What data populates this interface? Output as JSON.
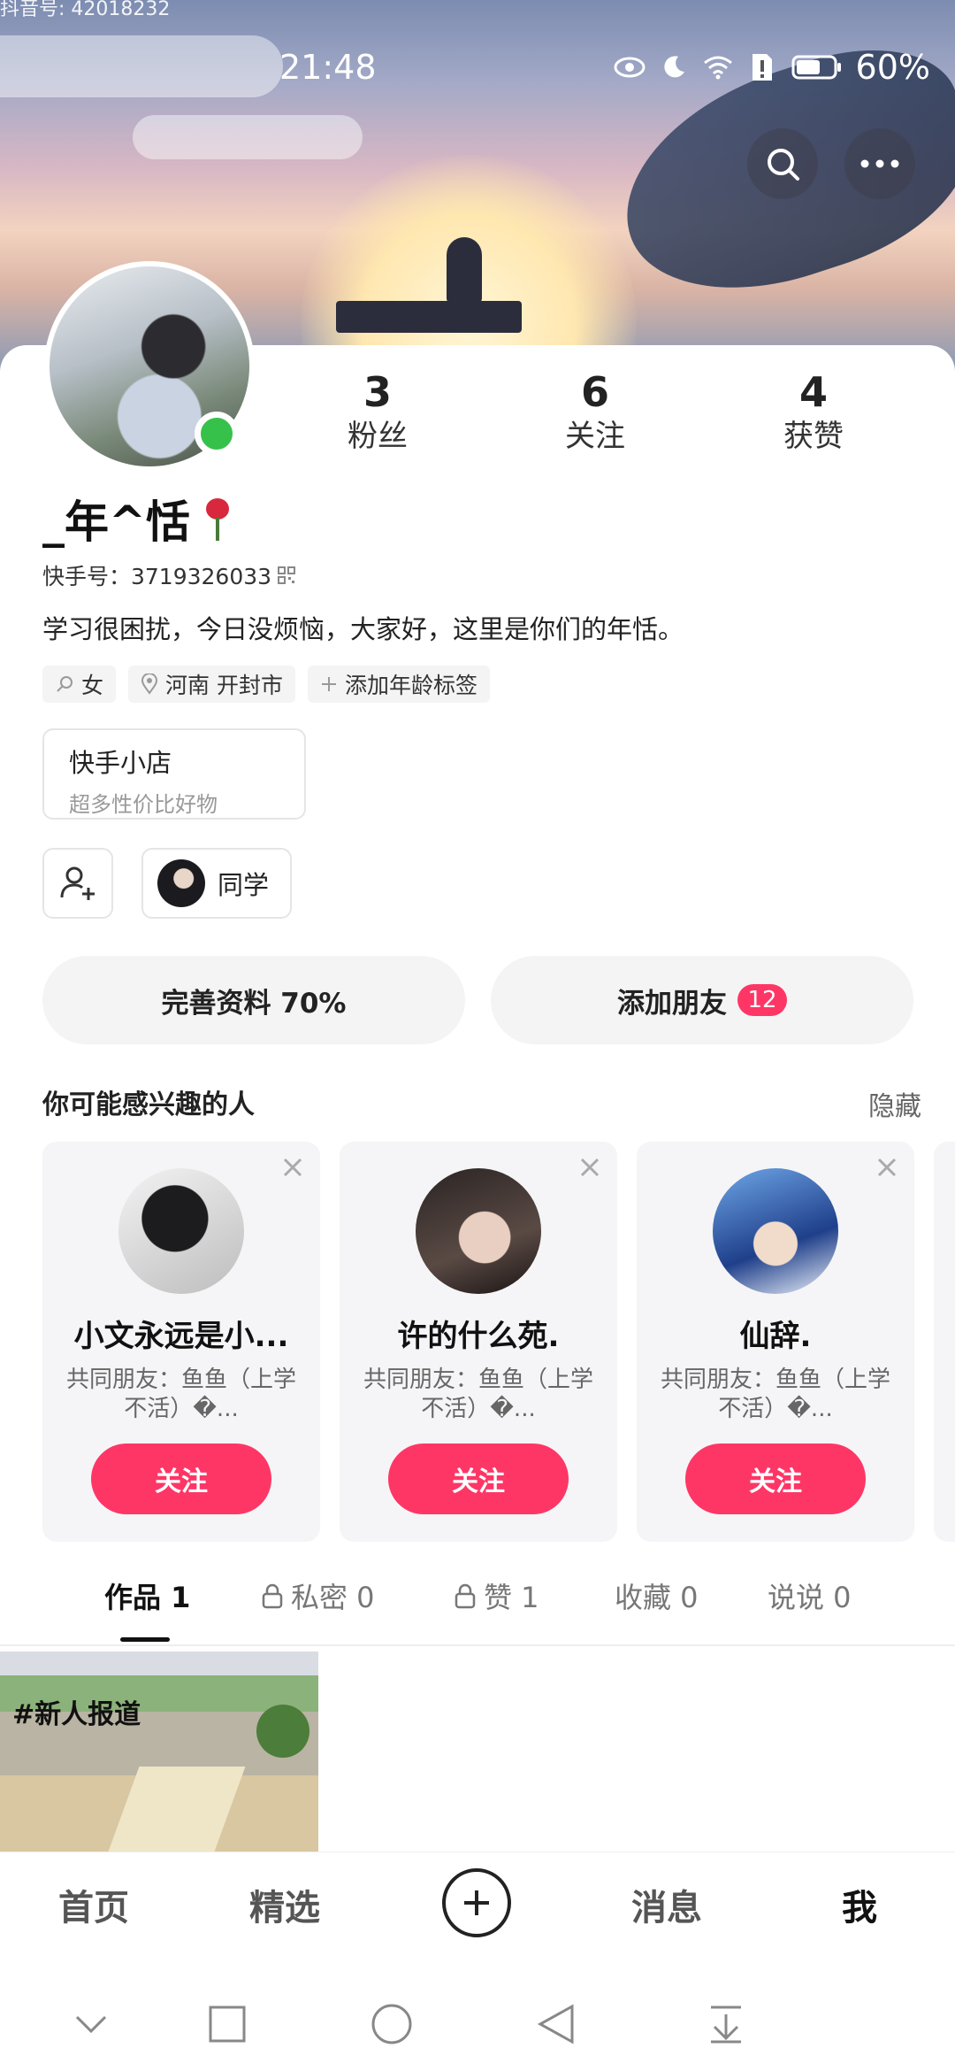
{
  "top_id": "抖音号: 42018232",
  "status": {
    "time": "21:48",
    "battery": "60%"
  },
  "stats": [
    {
      "num": "3",
      "label": "粉丝"
    },
    {
      "num": "6",
      "label": "关注"
    },
    {
      "num": "4",
      "label": "获赞"
    }
  ],
  "profile": {
    "nickname": "_年^恬",
    "kid_label": "快手号：3719326033",
    "bio": "学习很困扰，今日没烦恼，大家好，这里是你们的年恬。",
    "tags": [
      "女",
      "河南 开封市",
      "添加年龄标签"
    ]
  },
  "shop": {
    "title": "快手小店",
    "subtitle": "超多性价比好物"
  },
  "classmate_label": "同学",
  "actions": {
    "complete_profile": "完善资料 70%",
    "add_friend": "添加朋友",
    "add_friend_badge": "12"
  },
  "recommend": {
    "title": "你可能感兴趣的人",
    "hide": "隐藏",
    "cards": [
      {
        "name": "小文永远是小...",
        "sub": "共同朋友：鱼鱼（上学不活）�...",
        "follow": "关注"
      },
      {
        "name": "许的什么苑.",
        "sub": "共同朋友：鱼鱼（上学不活）�...",
        "follow": "关注"
      },
      {
        "name": "仙辞.",
        "sub": "共同朋友：鱼鱼（上学不活）�...",
        "follow": "关注"
      }
    ]
  },
  "tabs": {
    "works": "作品 1",
    "private": "私密 0",
    "likes": "赞 1",
    "favorites": "收藏 0",
    "posts": "说说 0"
  },
  "work_tag": "#新人报道",
  "bottom_nav": {
    "home": "首页",
    "featured": "精选",
    "messages": "消息",
    "me": "我"
  },
  "colors": {
    "accent": "#fe3666",
    "online": "#36c24a"
  }
}
